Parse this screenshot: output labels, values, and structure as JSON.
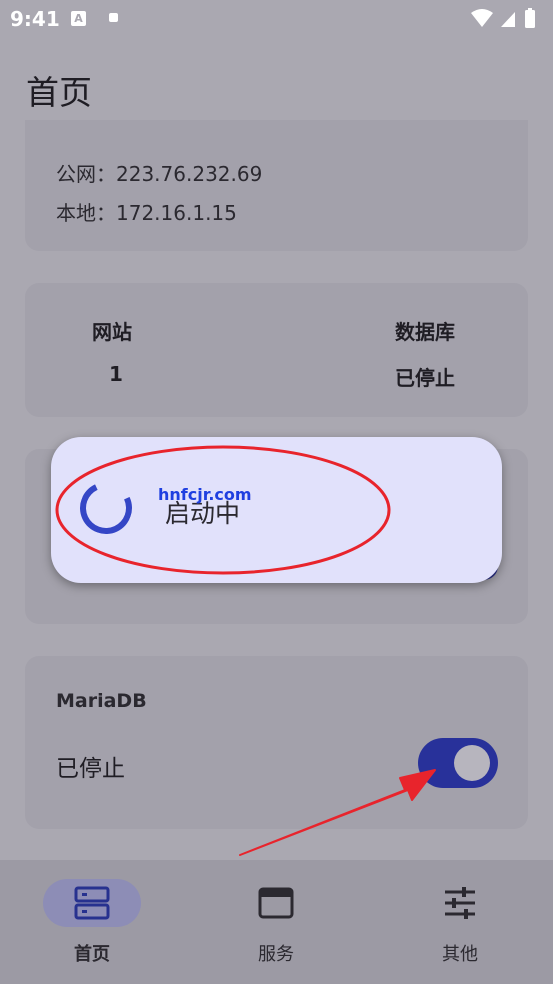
{
  "status_bar": {
    "time": "9:41",
    "notification_letter": "A"
  },
  "page": {
    "title": "首页"
  },
  "ip_card": {
    "public_label": "公网：",
    "public_value": "223.76.232.69",
    "local_label": "本地：",
    "local_value": "172.16.1.15"
  },
  "stats_card": {
    "site_label": "网站",
    "site_value": "1",
    "db_label": "数据库",
    "db_value": "已停止"
  },
  "dialog": {
    "text": "启动中",
    "watermark": "hnfcjr.com"
  },
  "mariadb_card": {
    "title": "MariaDB",
    "status": "已停止",
    "toggle_on": true
  },
  "bottom_nav": {
    "items": [
      {
        "label": "首页",
        "icon": "server-icon",
        "active": true
      },
      {
        "label": "服务",
        "icon": "window-icon",
        "active": false
      },
      {
        "label": "其他",
        "icon": "sliders-icon",
        "active": false
      }
    ]
  },
  "colors": {
    "accent": "#28319a",
    "spinner": "#3446c6",
    "annotation": "#e8242c"
  }
}
